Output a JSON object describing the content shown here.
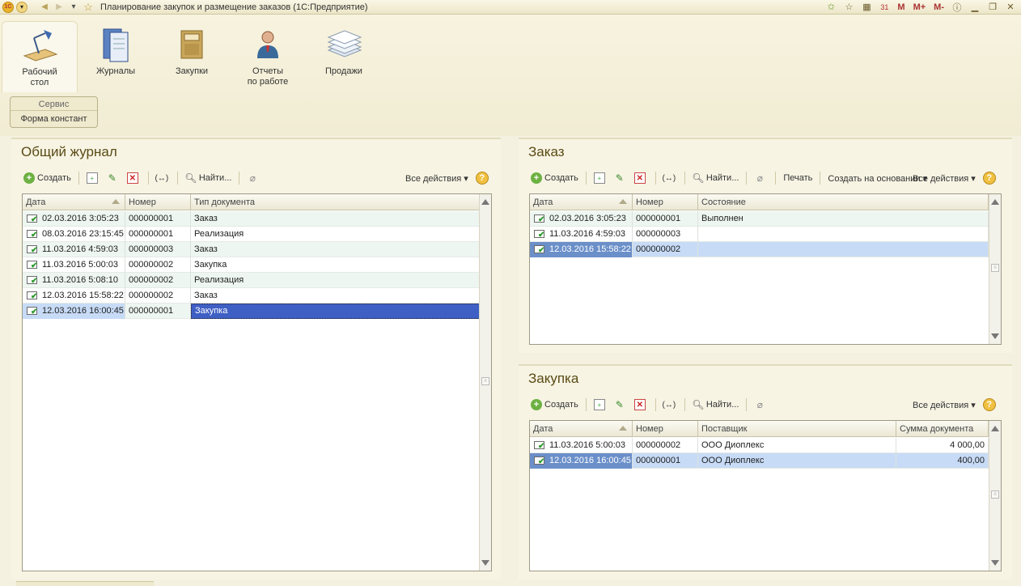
{
  "window": {
    "title": "Планирование закупок и размещение заказов  (1С:Предприятие)",
    "logo_text": "1С",
    "memory_buttons": [
      "M",
      "M+",
      "M-"
    ]
  },
  "sections": [
    {
      "label_line1": "Рабочий",
      "label_line2": "стол",
      "icon": "desk-lamp-icon"
    },
    {
      "label_line1": "Журналы",
      "label_line2": "",
      "icon": "journal-icon"
    },
    {
      "label_line1": "Закупки",
      "label_line2": "",
      "icon": "folder-icon"
    },
    {
      "label_line1": "Отчеты",
      "label_line2": "по работе",
      "icon": "person-icon"
    },
    {
      "label_line1": "Продажи",
      "label_line2": "",
      "icon": "papers-icon"
    }
  ],
  "service": {
    "title": "Сервис",
    "link": "Форма констант"
  },
  "common_journal": {
    "title": "Общий журнал",
    "toolbar": {
      "create": "Создать",
      "find": "Найти...",
      "all_actions": "Все действия ▾",
      "help": "?"
    },
    "columns": [
      "Дата",
      "Номер",
      "Тип документа"
    ],
    "rows": [
      [
        "02.03.2016 3:05:23",
        "000000001",
        "Заказ"
      ],
      [
        "08.03.2016 23:15:45",
        "000000001",
        "Реализация"
      ],
      [
        "11.03.2016 4:59:03",
        "000000003",
        "Заказ"
      ],
      [
        "11.03.2016 5:00:03",
        "000000002",
        "Закупка"
      ],
      [
        "11.03.2016 5:08:10",
        "000000002",
        "Реализация"
      ],
      [
        "12.03.2016 15:58:22",
        "000000002",
        "Заказ"
      ],
      [
        "12.03.2016 16:00:45",
        "000000001",
        "Закупка"
      ]
    ]
  },
  "order": {
    "title": "Заказ",
    "toolbar": {
      "create": "Создать",
      "find": "Найти...",
      "print": "Печать",
      "create_based": "Создать на основании ▾",
      "all_actions": "Все действия ▾",
      "help": "?"
    },
    "columns": [
      "Дата",
      "Номер",
      "Состояние"
    ],
    "rows": [
      [
        "02.03.2016 3:05:23",
        "000000001",
        "Выполнен"
      ],
      [
        "11.03.2016 4:59:03",
        "000000003",
        ""
      ],
      [
        "12.03.2016 15:58:22",
        "000000002",
        ""
      ]
    ]
  },
  "purchase": {
    "title": "Закупка",
    "toolbar": {
      "create": "Создать",
      "find": "Найти...",
      "all_actions": "Все действия ▾",
      "help": "?"
    },
    "columns": [
      "Дата",
      "Номер",
      "Поставщик",
      "Сумма документа"
    ],
    "rows": [
      [
        "11.03.2016 5:00:03",
        "000000002",
        "ООО Диоплекс",
        "4 000,00"
      ],
      [
        "12.03.2016 16:00:45",
        "000000001",
        "ООО Диоплекс",
        "400,00"
      ]
    ]
  }
}
